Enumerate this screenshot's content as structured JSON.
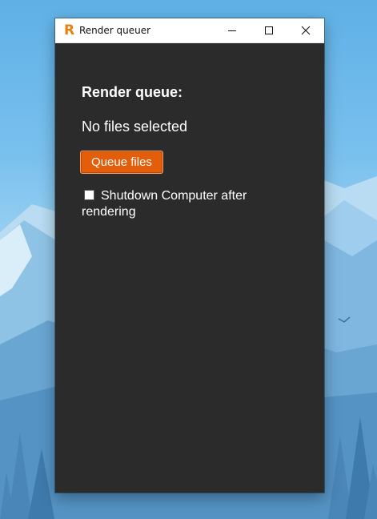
{
  "window": {
    "title": "Render queuer",
    "app_icon_letter": "R",
    "controls": [
      "minimize",
      "maximize",
      "close"
    ]
  },
  "main": {
    "heading": "Render queue:",
    "status": "No files selected",
    "queue_button_label": "Queue files",
    "shutdown_checkbox": {
      "label": "Shutdown Computer after rendering",
      "checked": false
    }
  },
  "colors": {
    "accent": "#e35d0b",
    "window_bg": "#2b2b2b",
    "app_icon": "#e8820c"
  }
}
